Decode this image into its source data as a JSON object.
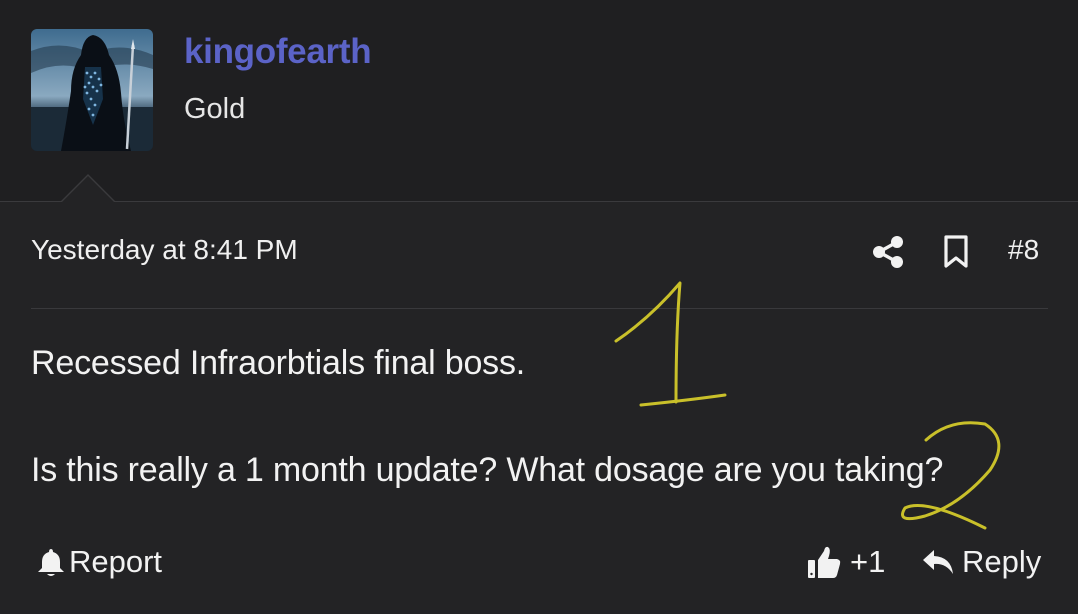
{
  "user": {
    "username": "kingofearth",
    "title": "Gold",
    "avatar_icon": "hooded-figure-avatar"
  },
  "post": {
    "timestamp": "Yesterday at 8:41 PM",
    "number": "#8",
    "lines": [
      "Recessed Infraorbtials final boss.",
      "Is this really a 1 month update? What dosage are you taking?"
    ]
  },
  "header_actions": {
    "share_icon": "share-icon",
    "bookmark_icon": "bookmark-icon"
  },
  "actions": {
    "report_label": "Report",
    "like_count": "+1",
    "reply_label": "Reply"
  },
  "annotations": {
    "marks": [
      "1",
      "2"
    ],
    "color": "#c9c02a"
  },
  "colors": {
    "background": "#232325",
    "header_background": "#1f1f21",
    "username": "#5b63c7",
    "text": "#f2f2f2"
  }
}
